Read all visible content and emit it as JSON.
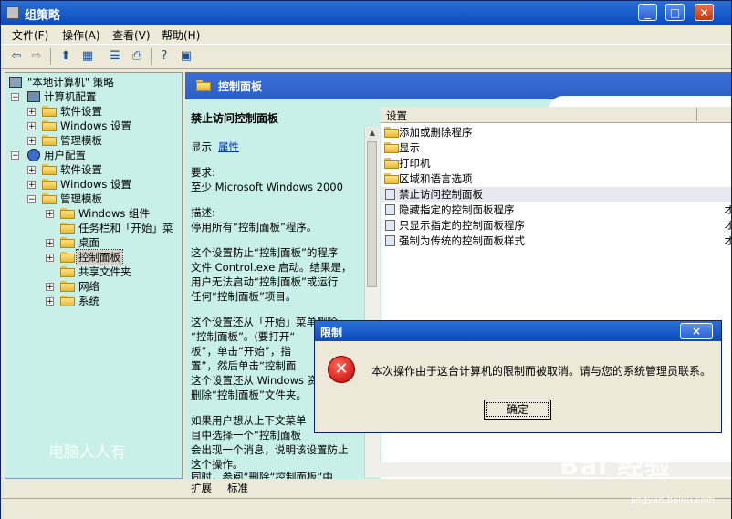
{
  "window": {
    "title": "组策略"
  },
  "menu": [
    "文件(F)",
    "操作(A)",
    "查看(V)",
    "帮助(H)"
  ],
  "toolbar": {
    "icons": [
      "back-arrow-icon",
      "forward-arrow-icon",
      "up-folder-icon",
      "show-tree-icon",
      "properties-icon",
      "export-icon",
      "help-icon",
      "console-icon"
    ]
  },
  "tree": {
    "root": "\"本地计算机\" 策略",
    "computer_config": "计算机配置",
    "cc_software": "软件设置",
    "cc_windows": "Windows 设置",
    "cc_admin": "管理模板",
    "user_config": "用户配置",
    "uc_software": "软件设置",
    "uc_windows": "Windows 设置",
    "uc_admin": "管理模板",
    "win_components": "Windows 组件",
    "taskbar": "任务栏和「开始」菜",
    "desktop": "桌面",
    "control_panel": "控制面板",
    "shared_folders": "共享文件夹",
    "network": "网络",
    "system": "系统"
  },
  "right_header": "控制面板",
  "description": {
    "title": "禁止访问控制面板",
    "show_label": "显示",
    "properties_link": "属性",
    "requirements_label": "要求:",
    "requirements_value": "至少 Microsoft Windows 2000",
    "desc_label": "描述:",
    "lines": [
      "停用所有“控制面板”程序。",
      "这个设置防止“控制面板”的程序",
      "文件 Control.exe 启动。结果是，",
      "用户无法启动“控制面板”或运行",
      "任何“控制面板”项目。",
      "这个设置还从「开始」菜单删除",
      "“控制面板”。(要打开“",
      "板”，单击“开始”，指",
      "置”，然后单击“控制面",
      "这个设置还从 Windows 资",
      "删除“控制面板”文件夹。",
      "如果用户想从上下文菜单",
      "目中选择一个“控制面板",
      "会出现一个消息，说明该设置防止",
      "这个操作。",
      "同时，参阅“删除“控制面板”中"
    ]
  },
  "list": {
    "header": "设置",
    "items": [
      {
        "label": "添加或删除程序",
        "type": "folder",
        "side": ""
      },
      {
        "label": "显示",
        "type": "folder",
        "side": ""
      },
      {
        "label": "打印机",
        "type": "folder",
        "side": ""
      },
      {
        "label": "区域和语言选项",
        "type": "folder",
        "side": ""
      },
      {
        "label": "禁止访问控制面板",
        "type": "policy",
        "side": ""
      },
      {
        "label": "隐藏指定的控制面板程序",
        "type": "policy",
        "side": "オ"
      },
      {
        "label": "只显示指定的控制面板程序",
        "type": "policy",
        "side": "オ"
      },
      {
        "label": "强制为传统的控制面板样式",
        "type": "policy",
        "side": "オ"
      }
    ]
  },
  "tabs": [
    "扩展",
    "标准"
  ],
  "dialog": {
    "title": "限制",
    "close": "×",
    "message": "本次操作由于这台计算机的限制而被取消。请与您的系统管理员联系。",
    "ok": "确定"
  },
  "watermark": "电脑人人有",
  "logo": {
    "main": "Bai 经验",
    "sub": "jingyan.baidu.com"
  }
}
